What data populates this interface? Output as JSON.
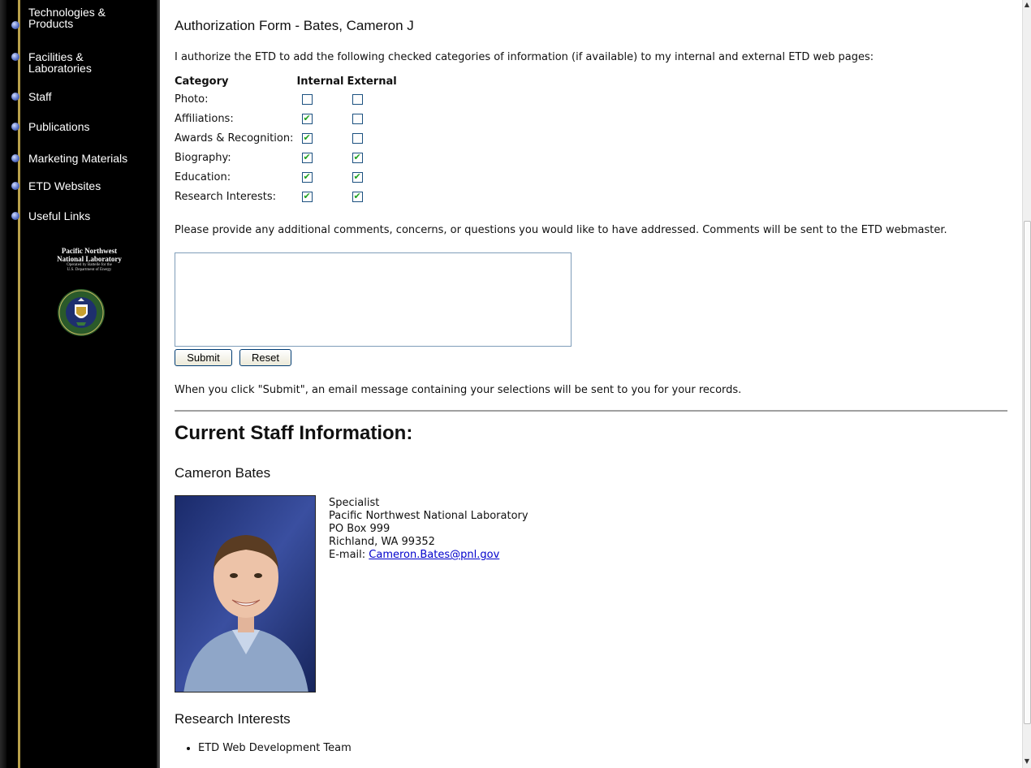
{
  "sidebar": {
    "items": [
      {
        "label": "Technologies &\nProducts"
      },
      {
        "label": "Facilities &\nLaboratories"
      },
      {
        "label": "Staff"
      },
      {
        "label": "Publications"
      },
      {
        "label": "Marketing Materials"
      },
      {
        "label": "ETD Websites"
      },
      {
        "label": "Useful Links"
      }
    ],
    "logo": {
      "line1": "Pacific Northwest",
      "line2": "National Laboratory",
      "line3": "Operated by Battelle for the",
      "line4": "U.S. Department of Energy"
    }
  },
  "form": {
    "title": "Authorization Form - Bates, Cameron J",
    "intro": "I authorize the ETD to add the following checked categories of information (if available) to my internal and external ETD web pages:",
    "headers": {
      "category": "Category",
      "internal": "Internal",
      "external": "External"
    },
    "rows": [
      {
        "label": "Photo:",
        "internal": false,
        "external": false
      },
      {
        "label": "Affiliations:",
        "internal": true,
        "external": false
      },
      {
        "label": "Awards & Recognition:",
        "internal": true,
        "external": false
      },
      {
        "label": "Biography:",
        "internal": true,
        "external": true
      },
      {
        "label": "Education:",
        "internal": true,
        "external": true
      },
      {
        "label": "Research Interests:",
        "internal": true,
        "external": true
      }
    ],
    "comments_note": "Please provide any additional comments, concerns, or questions you would like to have addressed. Comments will be sent to the ETD webmaster.",
    "comments_value": "",
    "submit_label": "Submit",
    "reset_label": "Reset",
    "submit_note": "When you click \"Submit\", an email message containing your selections will be sent to you for your records."
  },
  "staff": {
    "heading": "Current Staff Information:",
    "name": "Cameron Bates",
    "title": "Specialist",
    "org": "Pacific Northwest National Laboratory",
    "address1": "PO Box 999",
    "address2": "Richland, WA 99352",
    "email_label": "E-mail:",
    "email": "Cameron.Bates@pnl.gov",
    "research_heading": "Research Interests",
    "research_items": [
      "ETD Web Development Team"
    ]
  },
  "colors": {
    "sidebar_bg": "#000000",
    "sidebar_line": "#b8a04a",
    "link": "#0000cc",
    "checkmark": "#21a121"
  }
}
